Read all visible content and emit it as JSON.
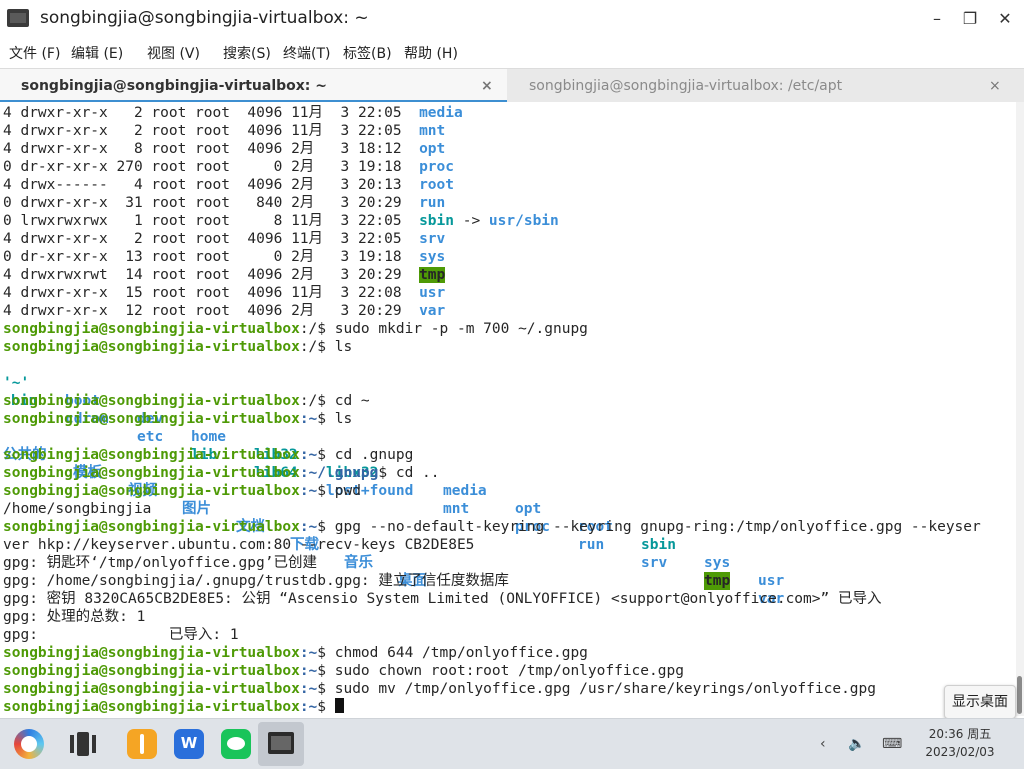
{
  "window": {
    "title": "songbingjia@songbingjia-virtualbox: ~",
    "controls": {
      "minimize": "–",
      "restore": "❐",
      "close": "✕"
    }
  },
  "menu": [
    "文件 (F)",
    "编辑 (E)",
    "视图 (V)",
    "搜索(S)",
    "终端(T)",
    "标签(B)",
    "帮助 (H)"
  ],
  "tabs": [
    {
      "label": "songbingjia@songbingjia-virtualbox: ~",
      "close": "×"
    },
    {
      "label": "songbingjia@songbingjia-virtualbox: /etc/apt",
      "close": "×"
    }
  ],
  "terminal": {
    "user": "songbingjia@songbingjia-virtualbox",
    "listing": [
      {
        "meta": "4 drwxr-xr-x   2 root root  4096 11月  3 22:05  ",
        "name": "media"
      },
      {
        "meta": "4 drwxr-xr-x   2 root root  4096 11月  3 22:05  ",
        "name": "mnt"
      },
      {
        "meta": "4 drwxr-xr-x   8 root root  4096 2月   3 18:12  ",
        "name": "opt"
      },
      {
        "meta": "0 dr-xr-xr-x 270 root root     0 2月   3 19:18  ",
        "name": "proc"
      },
      {
        "meta": "4 drwx------   4 root root  4096 2月   3 20:13  ",
        "name": "root"
      },
      {
        "meta": "0 drwxr-xr-x  31 root root   840 2月   3 20:29  ",
        "name": "run"
      },
      {
        "meta": "0 lrwxrwxrwx   1 root root     8 11月  3 22:05  ",
        "name": "sbin",
        "arrow": " -> ",
        "target": "usr/sbin"
      },
      {
        "meta": "4 drwxr-xr-x   2 root root  4096 11月  3 22:05  ",
        "name": "srv"
      },
      {
        "meta": "0 dr-xr-xr-x  13 root root     0 2月   3 19:18  ",
        "name": "sys"
      },
      {
        "meta": "4 drwxrwxrwt  14 root root  4096 2月   3 20:29  ",
        "name": "tmp"
      },
      {
        "meta": "4 drwxr-xr-x  15 root root  4096 11月  3 22:08  ",
        "name": "usr"
      },
      {
        "meta": "4 drwxr-xr-x  12 root root  4096 2月   3 20:29  ",
        "name": "var"
      }
    ],
    "cmds": {
      "mkdir": " sudo mkdir -p -m 700 ~/.gnupg",
      "ls": " ls",
      "cd_home": " cd ~",
      "cd_gnupg": " cd .gnupg",
      "cd_up": " cd ..",
      "pwd": " pwd",
      "gpg1": " gpg --no-default-keyring --keyring gnupg-ring:/tmp/onlyoffice.gpg --keyser",
      "gpg2": "ver hkp://keyserver.ubuntu.com:80 --recv-keys CB2DE8E5",
      "chmod": " chmod 644 /tmp/onlyoffice.gpg",
      "chown": " sudo chown root:root /tmp/onlyoffice.gpg",
      "mv": " sudo mv /tmp/onlyoffice.gpg /usr/share/keyrings/onlyoffice.gpg"
    },
    "paths": {
      "root": ":/",
      "home": ":~",
      "gnupg": ":~/.gnupg",
      "sign": "$"
    },
    "ls_row1": {
      "a": "'~'",
      "b": "boot",
      "c": "dev",
      "d": "home",
      "e": "lib32",
      "f": "libx32",
      "g": "media",
      "h": "opt",
      "i": "root",
      "j": "sbin",
      "k": "sys",
      "l": "usr"
    },
    "ls_row2": {
      "a": "bin",
      "b": "cdrom",
      "c": "etc",
      "d": "lib",
      "e": "lib64",
      "f": "lost+found",
      "g": "mnt",
      "h": "proc",
      "i": "run",
      "j": "srv",
      "k": "tmp",
      "l": "var"
    },
    "home_dirs": [
      "公共的",
      "模板",
      "视频",
      "图片",
      "文档",
      "下载",
      "音乐",
      "桌面"
    ],
    "pwd_out": "/home/songbingjia",
    "gpg_out": [
      "gpg: 钥匙环‘/tmp/onlyoffice.gpg’已创建",
      "gpg: /home/songbingjia/.gnupg/trustdb.gpg: 建立了信任度数据库",
      "gpg: 密钥 8320CA65CB2DE8E5: 公钥 “Ascensio System Limited (ONLYOFFICE) <support@onlyoffice.com>” 已导入",
      "gpg: 处理的总数: 1",
      "gpg:               已导入: 1"
    ]
  },
  "tooltip": "显示桌面",
  "taskbar": {
    "apps": [
      "kylin-start-icon",
      "multitask-view-icon",
      "file-manager-icon",
      "wps-icon",
      "wechat-icon",
      "terminal-icon"
    ],
    "tray": {
      "expand": "‹",
      "volume": "🔈",
      "keyboard": "⌨"
    },
    "time": "20:36 周五",
    "date": "2023/02/03"
  }
}
